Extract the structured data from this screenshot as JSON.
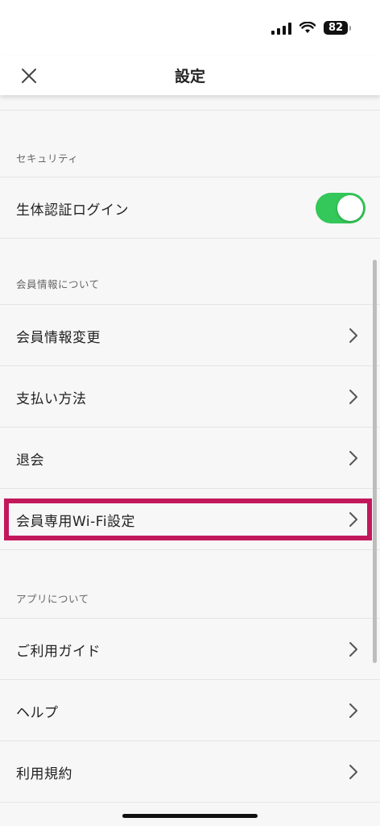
{
  "status_bar": {
    "battery": "82"
  },
  "nav": {
    "title": "設定",
    "close_icon": "close-icon"
  },
  "sections": {
    "security": {
      "header": "セキュリティ",
      "biometric_label": "生体認証ログイン",
      "biometric_enabled": true
    },
    "member": {
      "header": "会員情報について",
      "items": [
        "会員情報変更",
        "支払い方法",
        "退会",
        "会員専用Wi-Fi設定"
      ]
    },
    "app": {
      "header": "アプリについて",
      "items": [
        "ご利用ガイド",
        "ヘルプ",
        "利用規約"
      ]
    }
  },
  "colors": {
    "toggle_on": "#34c759",
    "highlight": "#c2185b"
  }
}
